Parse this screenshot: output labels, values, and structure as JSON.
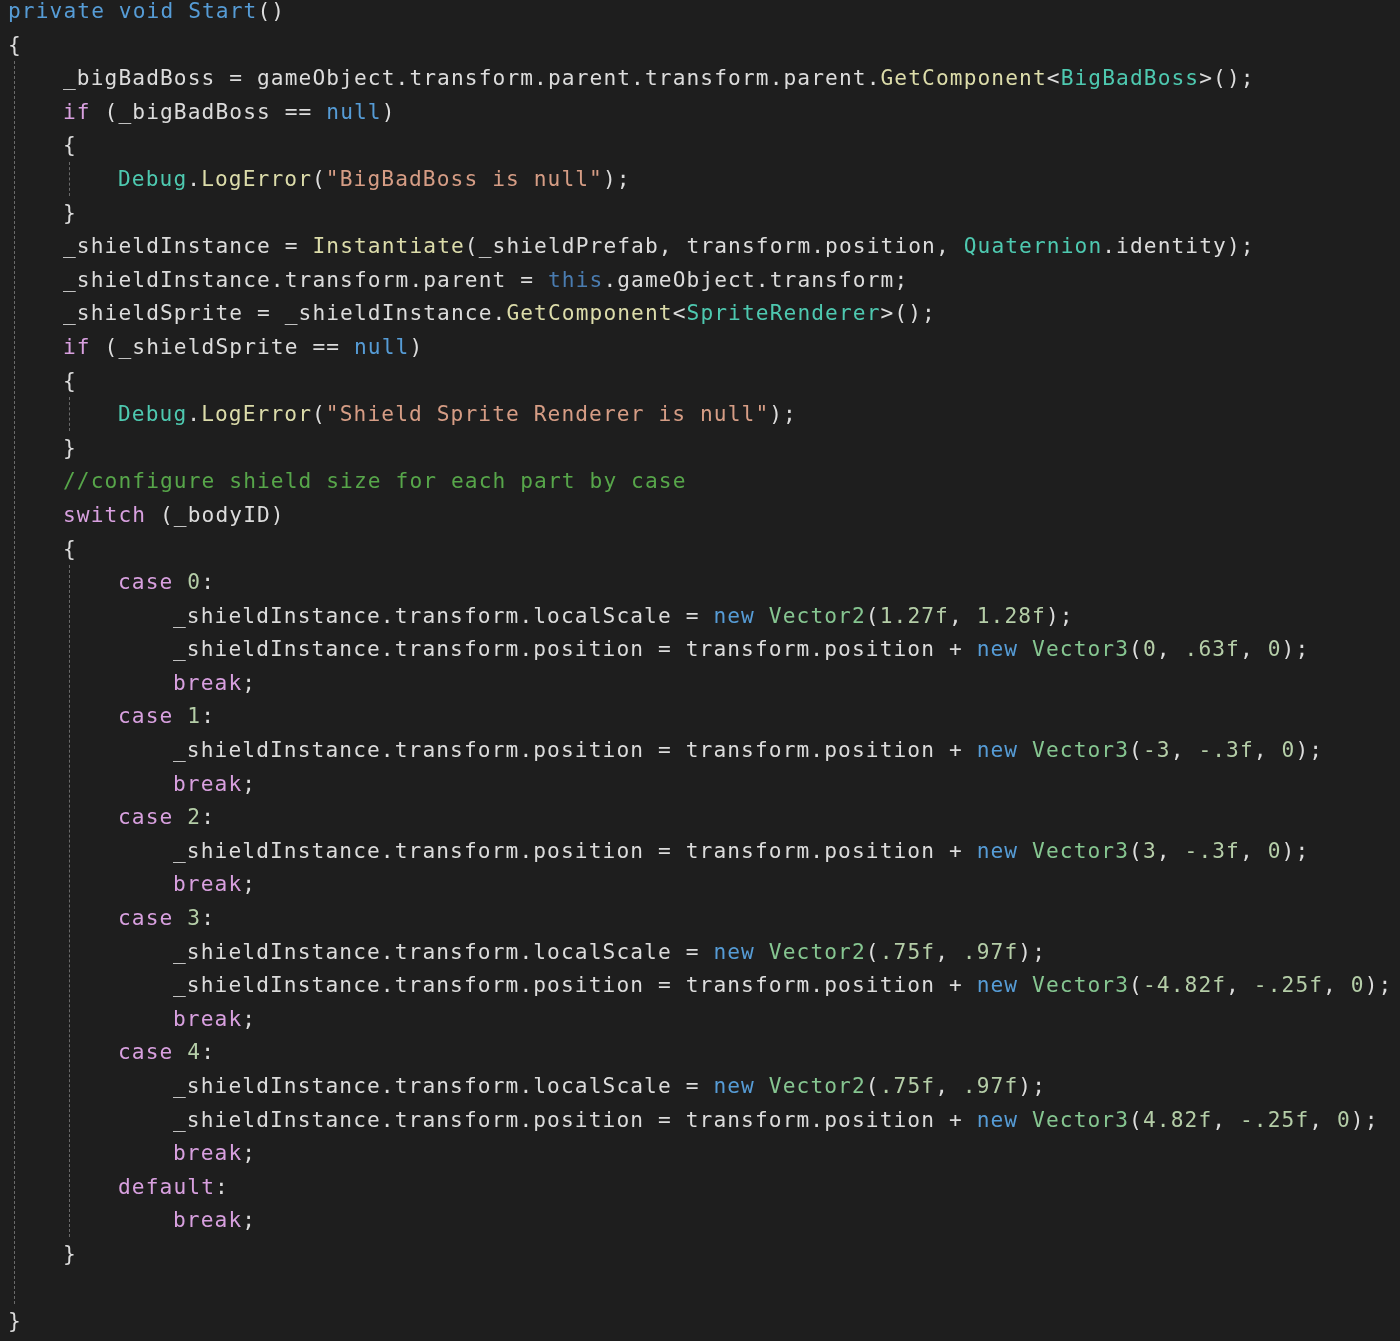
{
  "editor": {
    "lines": [
      {
        "kind": "code",
        "tokens": [
          {
            "kind": "keyword",
            "text": "private void "
          },
          {
            "kind": "keyword",
            "text": "Start"
          },
          {
            "kind": "plain",
            "text": "()"
          }
        ]
      },
      {
        "kind": "code",
        "tokens": [
          {
            "kind": "plain",
            "text": "{"
          }
        ],
        "guide": true,
        "children": [
          {
            "kind": "code",
            "tokens": [
              {
                "kind": "plain",
                "text": "_bigBadBoss = gameObject.transform.parent.transform.parent."
              },
              {
                "kind": "method",
                "text": "GetComponent"
              },
              {
                "kind": "plain",
                "text": "<"
              },
              {
                "kind": "type",
                "text": "BigBadBoss"
              },
              {
                "kind": "plain",
                "text": ">();"
              }
            ]
          },
          {
            "kind": "code",
            "tokens": [
              {
                "kind": "control",
                "text": "if"
              },
              {
                "kind": "plain",
                "text": " (_bigBadBoss == "
              },
              {
                "kind": "keyword",
                "text": "null"
              },
              {
                "kind": "plain",
                "text": ")"
              }
            ]
          },
          {
            "kind": "code",
            "tokens": [
              {
                "kind": "plain",
                "text": "{"
              }
            ],
            "guide": true,
            "children": [
              {
                "kind": "code",
                "tokens": [
                  {
                    "kind": "type",
                    "text": "Debug"
                  },
                  {
                    "kind": "plain",
                    "text": "."
                  },
                  {
                    "kind": "method",
                    "text": "LogError"
                  },
                  {
                    "kind": "plain",
                    "text": "("
                  },
                  {
                    "kind": "string",
                    "text": "\"BigBadBoss is null\""
                  },
                  {
                    "kind": "plain",
                    "text": ");"
                  }
                ]
              }
            ]
          },
          {
            "kind": "code",
            "tokens": [
              {
                "kind": "plain",
                "text": "}"
              }
            ]
          },
          {
            "kind": "code",
            "tokens": [
              {
                "kind": "plain",
                "text": "_shieldInstance = "
              },
              {
                "kind": "method",
                "text": "Instantiate"
              },
              {
                "kind": "plain",
                "text": "(_shieldPrefab, transform.position, "
              },
              {
                "kind": "type",
                "text": "Quaternion"
              },
              {
                "kind": "plain",
                "text": ".identity);"
              }
            ]
          },
          {
            "kind": "code",
            "tokens": [
              {
                "kind": "plain",
                "text": "_shieldInstance.transform.parent = "
              },
              {
                "kind": "this",
                "text": "this"
              },
              {
                "kind": "plain",
                "text": ".gameObject.transform;"
              }
            ]
          },
          {
            "kind": "code",
            "tokens": [
              {
                "kind": "plain",
                "text": "_shieldSprite = _shieldInstance."
              },
              {
                "kind": "method",
                "text": "GetComponent"
              },
              {
                "kind": "plain",
                "text": "<"
              },
              {
                "kind": "type",
                "text": "SpriteRenderer"
              },
              {
                "kind": "plain",
                "text": ">();"
              }
            ]
          },
          {
            "kind": "code",
            "tokens": [
              {
                "kind": "control",
                "text": "if"
              },
              {
                "kind": "plain",
                "text": " (_shieldSprite == "
              },
              {
                "kind": "keyword",
                "text": "null"
              },
              {
                "kind": "plain",
                "text": ")"
              }
            ]
          },
          {
            "kind": "code",
            "tokens": [
              {
                "kind": "plain",
                "text": "{"
              }
            ],
            "guide": true,
            "children": [
              {
                "kind": "code",
                "tokens": [
                  {
                    "kind": "type",
                    "text": "Debug"
                  },
                  {
                    "kind": "plain",
                    "text": "."
                  },
                  {
                    "kind": "method",
                    "text": "LogError"
                  },
                  {
                    "kind": "plain",
                    "text": "("
                  },
                  {
                    "kind": "string",
                    "text": "\"Shield Sprite Renderer is null\""
                  },
                  {
                    "kind": "plain",
                    "text": ");"
                  }
                ]
              }
            ]
          },
          {
            "kind": "code",
            "tokens": [
              {
                "kind": "plain",
                "text": "}"
              }
            ]
          },
          {
            "kind": "code",
            "tokens": [
              {
                "kind": "comment",
                "text": "//configure shield size for each part by case"
              }
            ]
          },
          {
            "kind": "code",
            "tokens": [
              {
                "kind": "control",
                "text": "switch"
              },
              {
                "kind": "plain",
                "text": " (_bodyID)"
              }
            ]
          },
          {
            "kind": "code",
            "tokens": [
              {
                "kind": "plain",
                "text": "{"
              }
            ],
            "guide": true,
            "children": [
              {
                "kind": "code",
                "tokens": [
                  {
                    "kind": "control",
                    "text": "case "
                  },
                  {
                    "kind": "number",
                    "text": "0"
                  },
                  {
                    "kind": "plain",
                    "text": ":"
                  }
                ],
                "guide": false,
                "children": [
                  {
                    "kind": "code",
                    "tokens": [
                      {
                        "kind": "plain",
                        "text": "_shieldInstance.transform.localScale = "
                      },
                      {
                        "kind": "keyword",
                        "text": "new "
                      },
                      {
                        "kind": "struct",
                        "text": "Vector2"
                      },
                      {
                        "kind": "plain",
                        "text": "("
                      },
                      {
                        "kind": "number",
                        "text": "1.27f"
                      },
                      {
                        "kind": "plain",
                        "text": ", "
                      },
                      {
                        "kind": "number",
                        "text": "1.28f"
                      },
                      {
                        "kind": "plain",
                        "text": ");"
                      }
                    ]
                  },
                  {
                    "kind": "code",
                    "tokens": [
                      {
                        "kind": "plain",
                        "text": "_shieldInstance.transform.position = transform.position + "
                      },
                      {
                        "kind": "keyword",
                        "text": "new "
                      },
                      {
                        "kind": "struct",
                        "text": "Vector3"
                      },
                      {
                        "kind": "plain",
                        "text": "("
                      },
                      {
                        "kind": "number",
                        "text": "0"
                      },
                      {
                        "kind": "plain",
                        "text": ", "
                      },
                      {
                        "kind": "number",
                        "text": ".63f"
                      },
                      {
                        "kind": "plain",
                        "text": ", "
                      },
                      {
                        "kind": "number",
                        "text": "0"
                      },
                      {
                        "kind": "plain",
                        "text": ");"
                      }
                    ]
                  },
                  {
                    "kind": "code",
                    "tokens": [
                      {
                        "kind": "control",
                        "text": "break"
                      },
                      {
                        "kind": "plain",
                        "text": ";"
                      }
                    ]
                  }
                ]
              },
              {
                "kind": "code",
                "tokens": [
                  {
                    "kind": "control",
                    "text": "case "
                  },
                  {
                    "kind": "number",
                    "text": "1"
                  },
                  {
                    "kind": "plain",
                    "text": ":"
                  }
                ],
                "guide": false,
                "children": [
                  {
                    "kind": "code",
                    "tokens": [
                      {
                        "kind": "plain",
                        "text": "_shieldInstance.transform.position = transform.position + "
                      },
                      {
                        "kind": "keyword",
                        "text": "new "
                      },
                      {
                        "kind": "struct",
                        "text": "Vector3"
                      },
                      {
                        "kind": "plain",
                        "text": "("
                      },
                      {
                        "kind": "number",
                        "text": "-3"
                      },
                      {
                        "kind": "plain",
                        "text": ", "
                      },
                      {
                        "kind": "number",
                        "text": "-.3f"
                      },
                      {
                        "kind": "plain",
                        "text": ", "
                      },
                      {
                        "kind": "number",
                        "text": "0"
                      },
                      {
                        "kind": "plain",
                        "text": ");"
                      }
                    ]
                  },
                  {
                    "kind": "code",
                    "tokens": [
                      {
                        "kind": "control",
                        "text": "break"
                      },
                      {
                        "kind": "plain",
                        "text": ";"
                      }
                    ]
                  }
                ]
              },
              {
                "kind": "code",
                "tokens": [
                  {
                    "kind": "control",
                    "text": "case "
                  },
                  {
                    "kind": "number",
                    "text": "2"
                  },
                  {
                    "kind": "plain",
                    "text": ":"
                  }
                ],
                "guide": false,
                "children": [
                  {
                    "kind": "code",
                    "tokens": [
                      {
                        "kind": "plain",
                        "text": "_shieldInstance.transform.position = transform.position + "
                      },
                      {
                        "kind": "keyword",
                        "text": "new "
                      },
                      {
                        "kind": "struct",
                        "text": "Vector3"
                      },
                      {
                        "kind": "plain",
                        "text": "("
                      },
                      {
                        "kind": "number",
                        "text": "3"
                      },
                      {
                        "kind": "plain",
                        "text": ", "
                      },
                      {
                        "kind": "number",
                        "text": "-.3f"
                      },
                      {
                        "kind": "plain",
                        "text": ", "
                      },
                      {
                        "kind": "number",
                        "text": "0"
                      },
                      {
                        "kind": "plain",
                        "text": ");"
                      }
                    ]
                  },
                  {
                    "kind": "code",
                    "tokens": [
                      {
                        "kind": "control",
                        "text": "break"
                      },
                      {
                        "kind": "plain",
                        "text": ";"
                      }
                    ]
                  }
                ]
              },
              {
                "kind": "code",
                "tokens": [
                  {
                    "kind": "control",
                    "text": "case "
                  },
                  {
                    "kind": "number",
                    "text": "3"
                  },
                  {
                    "kind": "plain",
                    "text": ":"
                  }
                ],
                "guide": false,
                "children": [
                  {
                    "kind": "code",
                    "tokens": [
                      {
                        "kind": "plain",
                        "text": "_shieldInstance.transform.localScale = "
                      },
                      {
                        "kind": "keyword",
                        "text": "new "
                      },
                      {
                        "kind": "struct",
                        "text": "Vector2"
                      },
                      {
                        "kind": "plain",
                        "text": "("
                      },
                      {
                        "kind": "number",
                        "text": ".75f"
                      },
                      {
                        "kind": "plain",
                        "text": ", "
                      },
                      {
                        "kind": "number",
                        "text": ".97f"
                      },
                      {
                        "kind": "plain",
                        "text": ");"
                      }
                    ]
                  },
                  {
                    "kind": "code",
                    "tokens": [
                      {
                        "kind": "plain",
                        "text": "_shieldInstance.transform.position = transform.position + "
                      },
                      {
                        "kind": "keyword",
                        "text": "new "
                      },
                      {
                        "kind": "struct",
                        "text": "Vector3"
                      },
                      {
                        "kind": "plain",
                        "text": "("
                      },
                      {
                        "kind": "number",
                        "text": "-4.82f"
                      },
                      {
                        "kind": "plain",
                        "text": ", "
                      },
                      {
                        "kind": "number",
                        "text": "-.25f"
                      },
                      {
                        "kind": "plain",
                        "text": ", "
                      },
                      {
                        "kind": "number",
                        "text": "0"
                      },
                      {
                        "kind": "plain",
                        "text": ");"
                      }
                    ]
                  },
                  {
                    "kind": "code",
                    "tokens": [
                      {
                        "kind": "control",
                        "text": "break"
                      },
                      {
                        "kind": "plain",
                        "text": ";"
                      }
                    ]
                  }
                ]
              },
              {
                "kind": "code",
                "tokens": [
                  {
                    "kind": "control",
                    "text": "case "
                  },
                  {
                    "kind": "number",
                    "text": "4"
                  },
                  {
                    "kind": "plain",
                    "text": ":"
                  }
                ],
                "guide": false,
                "children": [
                  {
                    "kind": "code",
                    "tokens": [
                      {
                        "kind": "plain",
                        "text": "_shieldInstance.transform.localScale = "
                      },
                      {
                        "kind": "keyword",
                        "text": "new "
                      },
                      {
                        "kind": "struct",
                        "text": "Vector2"
                      },
                      {
                        "kind": "plain",
                        "text": "("
                      },
                      {
                        "kind": "number",
                        "text": ".75f"
                      },
                      {
                        "kind": "plain",
                        "text": ", "
                      },
                      {
                        "kind": "number",
                        "text": ".97f"
                      },
                      {
                        "kind": "plain",
                        "text": ");"
                      }
                    ]
                  },
                  {
                    "kind": "code",
                    "tokens": [
                      {
                        "kind": "plain",
                        "text": "_shieldInstance.transform.position = transform.position + "
                      },
                      {
                        "kind": "keyword",
                        "text": "new "
                      },
                      {
                        "kind": "struct",
                        "text": "Vector3"
                      },
                      {
                        "kind": "plain",
                        "text": "("
                      },
                      {
                        "kind": "number",
                        "text": "4.82f"
                      },
                      {
                        "kind": "plain",
                        "text": ", "
                      },
                      {
                        "kind": "number",
                        "text": "-.25f"
                      },
                      {
                        "kind": "plain",
                        "text": ", "
                      },
                      {
                        "kind": "number",
                        "text": "0"
                      },
                      {
                        "kind": "plain",
                        "text": ");"
                      }
                    ]
                  },
                  {
                    "kind": "code",
                    "tokens": [
                      {
                        "kind": "control",
                        "text": "break"
                      },
                      {
                        "kind": "plain",
                        "text": ";"
                      }
                    ]
                  }
                ]
              },
              {
                "kind": "code",
                "tokens": [
                  {
                    "kind": "control",
                    "text": "default"
                  },
                  {
                    "kind": "plain",
                    "text": ":"
                  }
                ],
                "guide": false,
                "children": [
                  {
                    "kind": "code",
                    "tokens": [
                      {
                        "kind": "control",
                        "text": "break"
                      },
                      {
                        "kind": "plain",
                        "text": ";"
                      }
                    ]
                  }
                ]
              }
            ]
          },
          {
            "kind": "code",
            "tokens": [
              {
                "kind": "plain",
                "text": "}"
              }
            ]
          },
          {
            "kind": "blank"
          }
        ]
      },
      {
        "kind": "code",
        "tokens": [
          {
            "kind": "plain",
            "text": "}"
          }
        ]
      }
    ]
  }
}
